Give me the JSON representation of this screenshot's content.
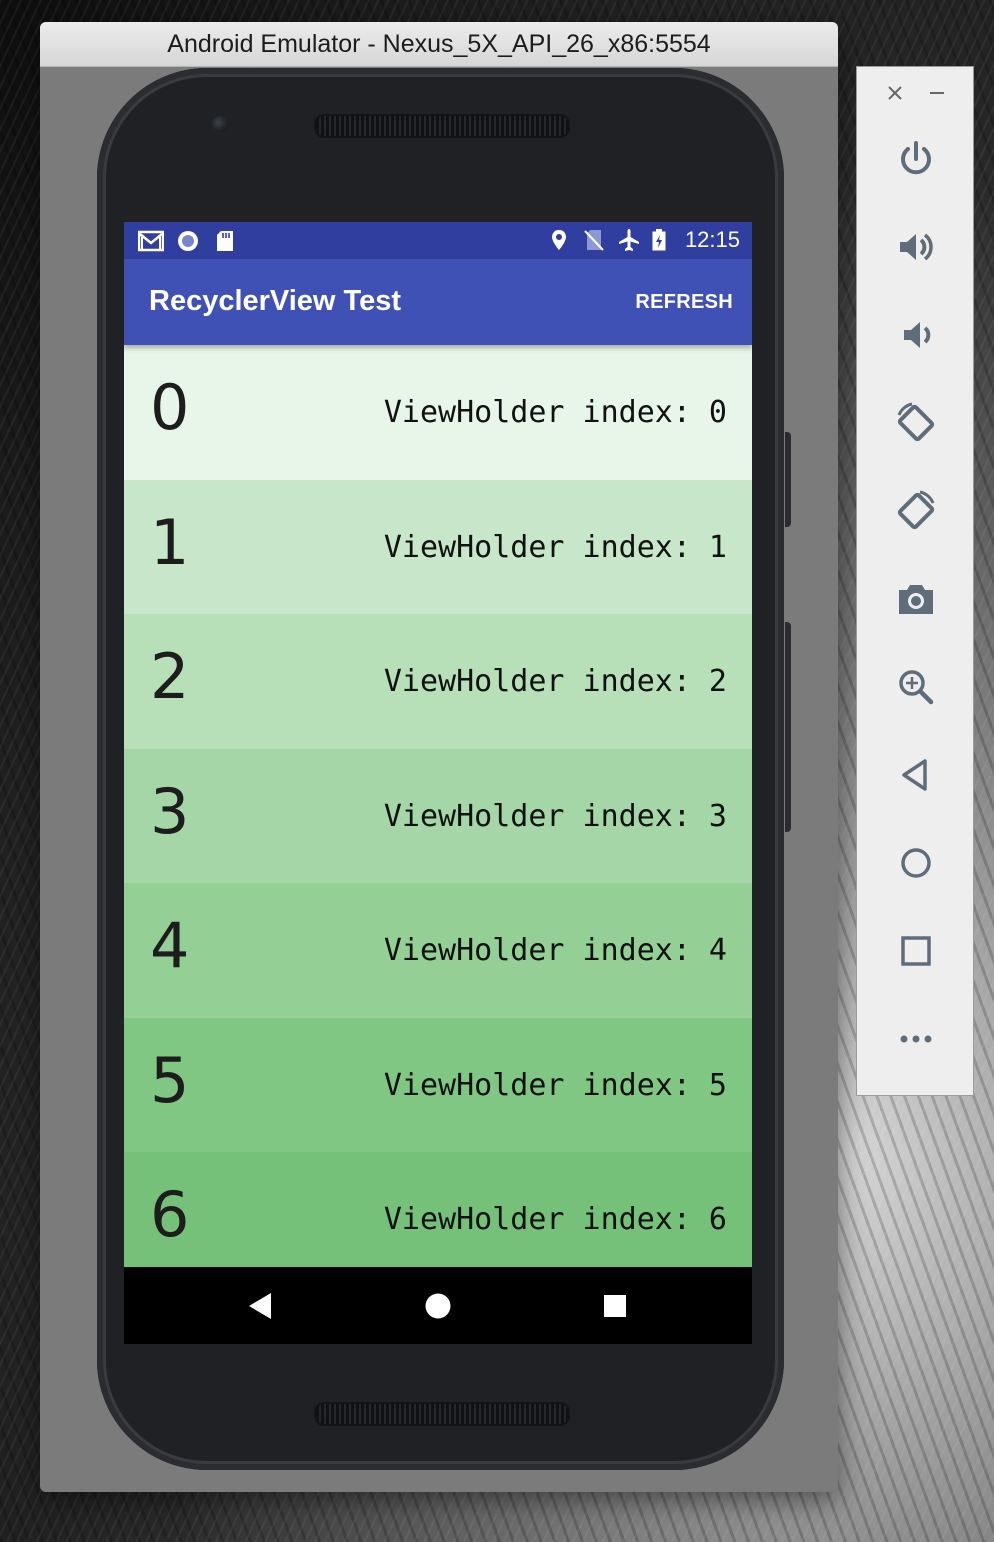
{
  "window": {
    "title": "Android Emulator - Nexus_5X_API_26_x86:5554"
  },
  "status_bar": {
    "time": "12:15",
    "left_icons": [
      "gmail-icon",
      "sync-icon",
      "sd-card-icon"
    ],
    "right_icons": [
      "location-icon",
      "no-sim-icon",
      "airplane-mode-icon",
      "battery-charging-icon"
    ],
    "color": "#303f9f"
  },
  "app_bar": {
    "title": "RecyclerView Test",
    "action": "REFRESH",
    "color": "#3f51b5"
  },
  "list": {
    "items": [
      {
        "number": "0",
        "label": "ViewHolder index: 0",
        "color": "#e8f5e9"
      },
      {
        "number": "1",
        "label": "ViewHolder index: 1",
        "color": "#c8e6c9"
      },
      {
        "number": "2",
        "label": "ViewHolder index: 2",
        "color": "#b7dfb8"
      },
      {
        "number": "3",
        "label": "ViewHolder index: 3",
        "color": "#a5d6a7"
      },
      {
        "number": "4",
        "label": "ViewHolder index: 4",
        "color": "#94cf96"
      },
      {
        "number": "5",
        "label": "ViewHolder index: 5",
        "color": "#81c784"
      },
      {
        "number": "6",
        "label": "ViewHolder index: 6",
        "color": "#75c17a"
      }
    ]
  },
  "nav_bar": {
    "buttons": [
      "back-icon",
      "home-icon",
      "recents-icon"
    ]
  },
  "toolbar": {
    "window_controls": [
      "close-icon",
      "minimize-icon"
    ],
    "buttons": [
      "power-icon",
      "volume-up-icon",
      "volume-down-icon",
      "rotate-left-icon",
      "rotate-right-icon",
      "camera-icon",
      "zoom-icon",
      "back-icon",
      "home-icon",
      "overview-icon",
      "more-icon"
    ]
  }
}
